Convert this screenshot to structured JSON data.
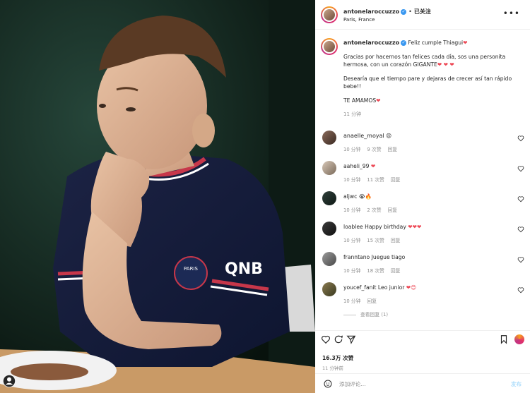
{
  "post": {
    "username": "antonelaroccuzzo",
    "verified_glyph": "✓",
    "follow_status": "已关注",
    "location": "Paris, France",
    "more_icon": "more-horizontal-icon",
    "photo_text": {
      "club_badge": "PARIS",
      "sponsor": "QNB"
    }
  },
  "caption": {
    "username": "antonelaroccuzzo",
    "title": "Feliz cumple Thiagui",
    "para1": "Gracias por hacernos tan felices cada día, sos una personita hermosa, con un corazón GIGANTE",
    "para2": "Desearía que el tiempo pare y dejaras de crecer así tan rápido bebe!!",
    "para3": "TE AMAMOS",
    "time": "11 分钟"
  },
  "comments": [
    {
      "user": "anaelle_moyal",
      "text": "",
      "emoji": "😍",
      "time": "10 分钟",
      "likes": "9 次赞",
      "reply": "回复"
    },
    {
      "user": "aaheli_99",
      "text": "",
      "emoji": "❤",
      "time": "10 分钟",
      "likes": "11 次赞",
      "reply": "回复"
    },
    {
      "user": "aljwc",
      "text": "",
      "emoji": "😭🔥",
      "time": "10 分钟",
      "likes": "2 次赞",
      "reply": "回复"
    },
    {
      "user": "loablee",
      "text": "Happy birthday",
      "emoji": "❤❤❤",
      "time": "10 分钟",
      "likes": "15 次赞",
      "reply": "回复"
    },
    {
      "user": "franntano",
      "text": "Juegue tiago",
      "emoji": "",
      "time": "10 分钟",
      "likes": "18 次赞",
      "reply": "回复"
    },
    {
      "user": "youcef_fanit",
      "text": "Leo junior",
      "emoji": "❤😍",
      "time": "10 分钟",
      "likes": "",
      "reply": "回复"
    }
  ],
  "view_replies": "查看回复 (1)",
  "actions": {
    "likes": "16.3万 次赞",
    "ago": "11 分钟前"
  },
  "add_comment": {
    "placeholder": "添加评论...",
    "post_label": "发布"
  },
  "colors": {
    "heart": "#ed4956",
    "verified": "#3897f0",
    "link_disabled": "#b2dffc"
  }
}
